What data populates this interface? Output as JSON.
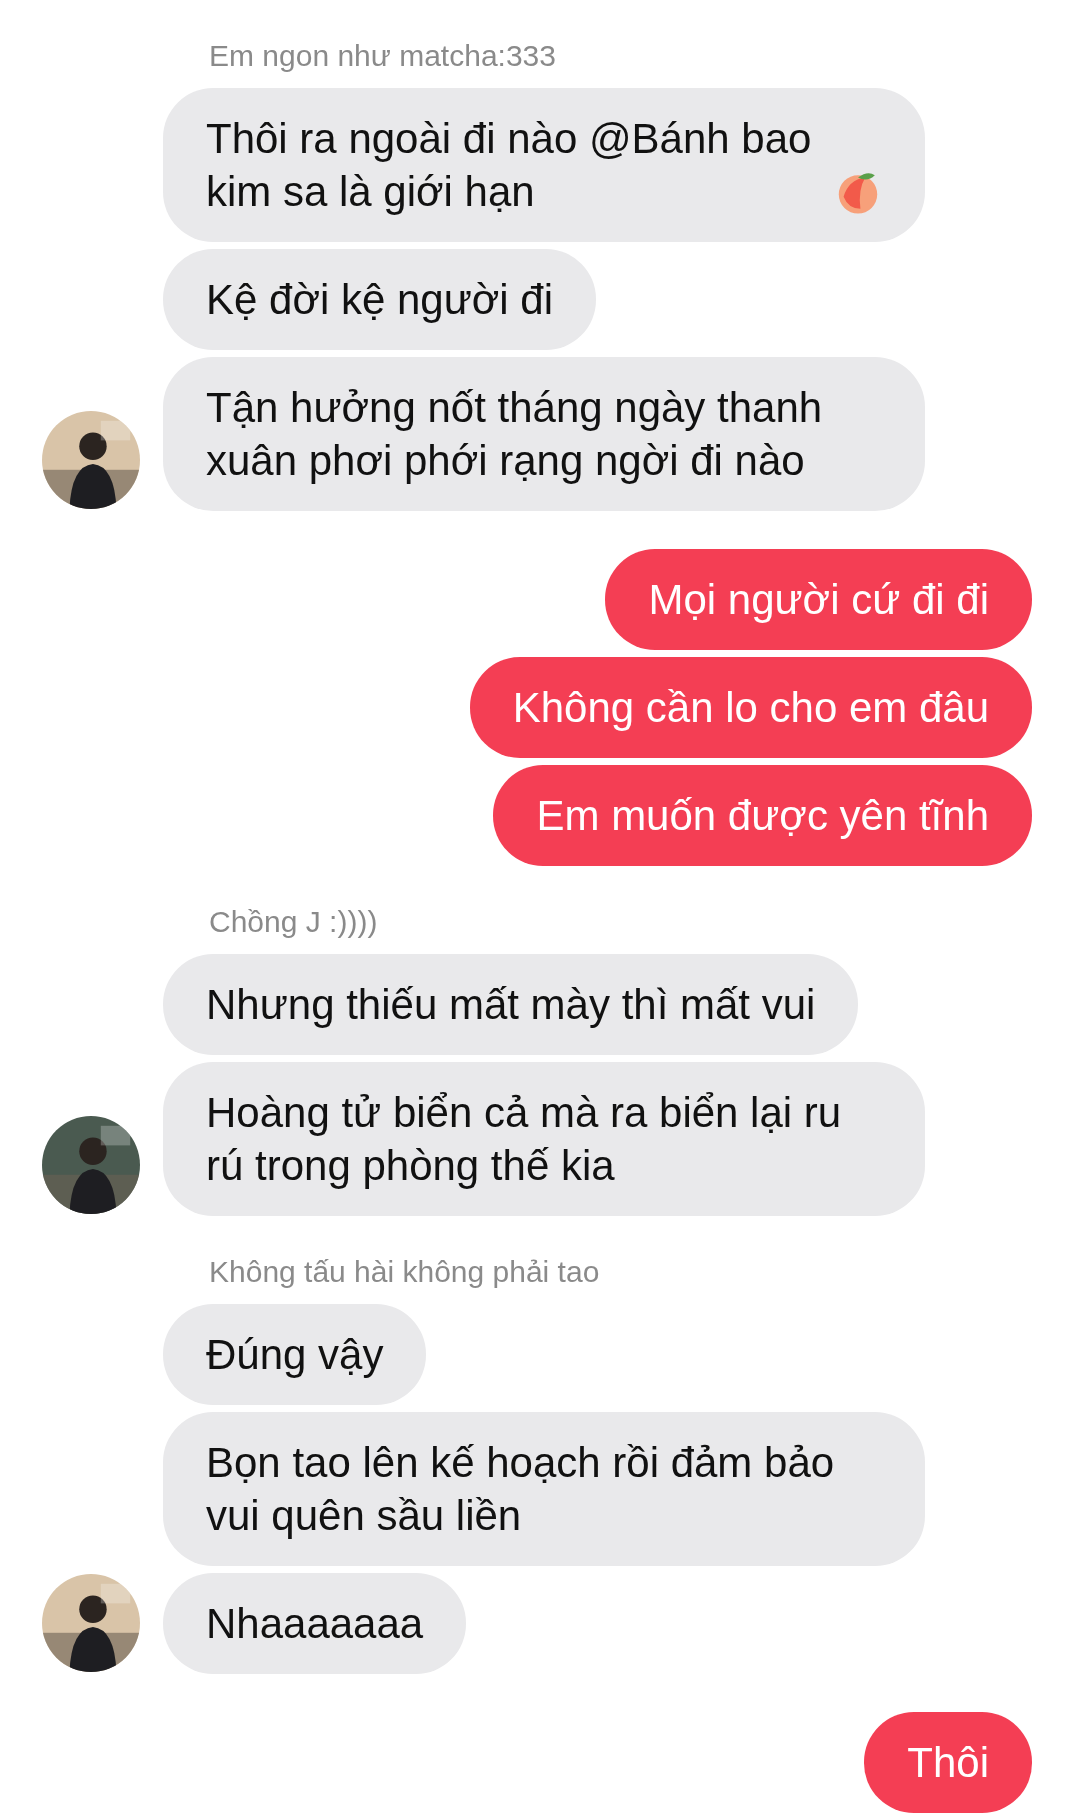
{
  "groups": [
    {
      "kind": "incoming",
      "sender": "Em ngon như matcha:333",
      "avatar": {
        "kind": "picture"
      },
      "messages": [
        {
          "text": "Thôi ra ngoài đi nào @Bánh bao kim sa là giới hạn",
          "kind": "with_peach"
        },
        {
          "text": "Kệ đời kệ người đi"
        },
        {
          "text": "Tận hưởng nốt tháng ngày thanh xuân phơi phới rạng ngời đi nào"
        }
      ]
    },
    {
      "kind": "outgoing",
      "messages": [
        {
          "text": "Mọi người cứ đi đi"
        },
        {
          "text": "Không cần lo cho em đâu"
        },
        {
          "text": "Em muốn được yên tĩnh"
        }
      ]
    },
    {
      "kind": "incoming",
      "sender": "Chồng J :))))",
      "avatar": {
        "kind": "picture"
      },
      "messages": [
        {
          "text": "Nhưng thiếu mất mày thì mất vui"
        },
        {
          "text": "Hoàng tử biển cả mà ra biển lại ru rú trong phòng thế kia"
        }
      ]
    },
    {
      "kind": "incoming",
      "sender": "Không tấu hài không phải tao",
      "avatar": {
        "kind": "picture"
      },
      "messages": [
        {
          "text": "Đúng vậy"
        },
        {
          "text": "Bọn tao lên kế hoạch rồi đảm bảo vui quên sầu liền"
        },
        {
          "text": "Nhaaaaaaa"
        }
      ]
    },
    {
      "kind": "outgoing",
      "messages": [
        {
          "text": "Thôi"
        }
      ]
    }
  ]
}
